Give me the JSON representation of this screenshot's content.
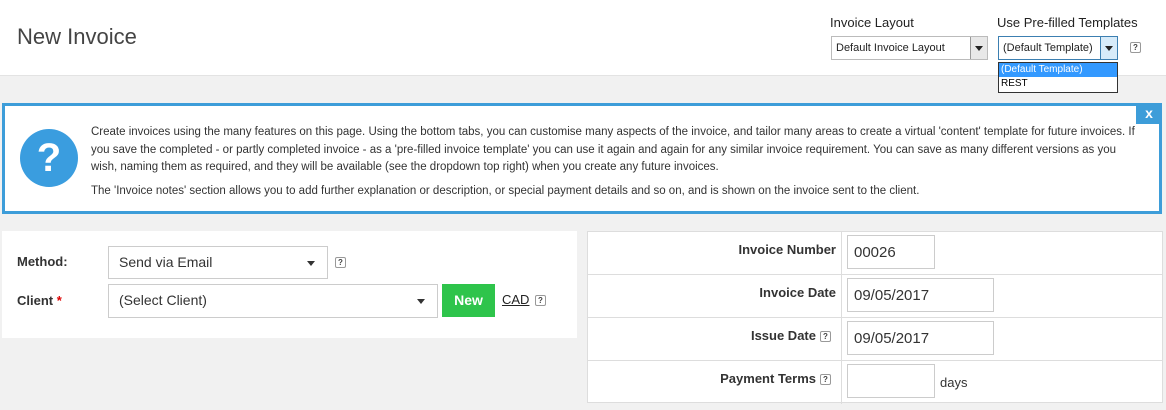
{
  "header": {
    "title": "New Invoice",
    "invoice_layout_label": "Invoice Layout",
    "invoice_layout_value": "Default Invoice Layout",
    "templates_label": "Use Pre-filled Templates",
    "templates_value": "(Default Template)",
    "templates_options": [
      "(Default Template)",
      "REST"
    ],
    "help_glyph": "?"
  },
  "info": {
    "icon": "question-icon",
    "icon_glyph": "?",
    "close_glyph": "x",
    "paragraph1": "Create invoices using the many features on this page. Using the bottom tabs, you can customise many aspects of the invoice, and tailor many areas to create a virtual 'content' template for future invoices. If you save the completed - or partly completed invoice - as a 'pre-filled invoice template' you can use it again and again for any similar invoice requirement. You can save as many different versions as you wish, naming them as required, and they will be available (see the dropdown top right) when you create any future invoices.",
    "paragraph2": "The 'Invoice notes' section allows you to add further explanation or description, or special payment details and so on, and is shown on the invoice sent to the client.",
    "accent_color": "#3d9dd9"
  },
  "form": {
    "method_label": "Method:",
    "method_value": "Send via Email",
    "client_label": "Client",
    "client_required": "*",
    "client_value": "(Select Client)",
    "new_button": "New",
    "currency_link": "CAD",
    "new_button_color": "#2ec44b"
  },
  "details": {
    "invoice_number_label": "Invoice Number",
    "invoice_number_value": "00026",
    "invoice_date_label": "Invoice Date",
    "invoice_date_value": "09/05/2017",
    "issue_date_label": "Issue Date",
    "issue_date_value": "09/05/2017",
    "payment_terms_label": "Payment Terms",
    "payment_terms_value": "",
    "days_label": "days"
  }
}
